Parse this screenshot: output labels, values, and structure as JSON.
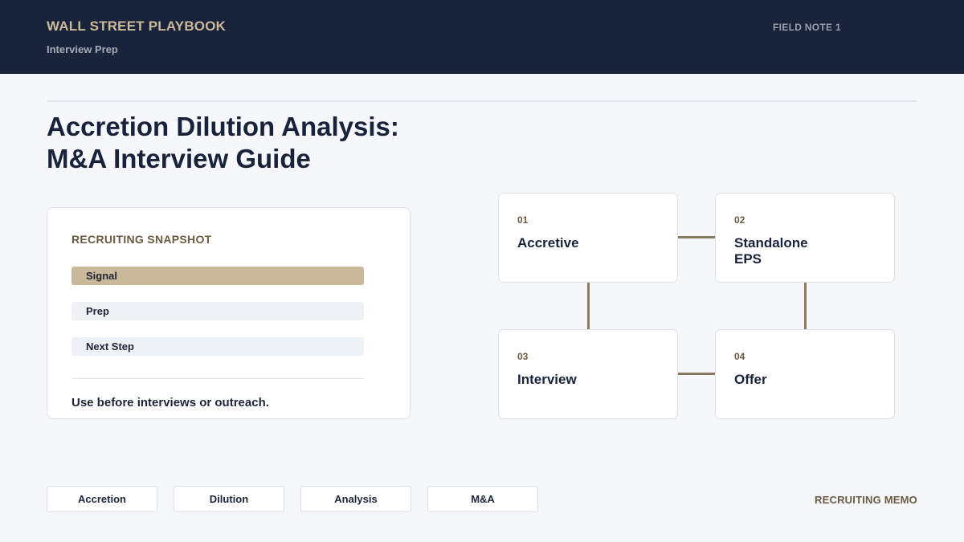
{
  "header": {
    "brand": "WALL STREET PLAYBOOK",
    "subtitle": "Interview Prep",
    "field_note": "FIELD NOTE 1"
  },
  "title": {
    "line1": "Accretion Dilution Analysis:",
    "line2": "M&A Interview Guide"
  },
  "snapshot": {
    "title": "RECRUITING SNAPSHOT",
    "items": [
      {
        "label": "Signal",
        "active": true
      },
      {
        "label": "Prep",
        "active": false
      },
      {
        "label": "Next Step",
        "active": false
      }
    ],
    "note": "Use before interviews or outreach."
  },
  "steps": [
    {
      "number": "01",
      "label": "Accretive"
    },
    {
      "number": "02",
      "label": "Standalone EPS"
    },
    {
      "number": "03",
      "label": "Interview"
    },
    {
      "number": "04",
      "label": "Offer"
    }
  ],
  "tags": [
    "Accretion",
    "Dilution",
    "Analysis",
    "M&A"
  ],
  "footer": {
    "memo": "RECRUITING MEMO"
  },
  "colors": {
    "header_bg": "#19233a",
    "accent_gold": "#c9b99a",
    "accent_brown": "#6b5a40",
    "page_bg": "#f5f7fa"
  }
}
